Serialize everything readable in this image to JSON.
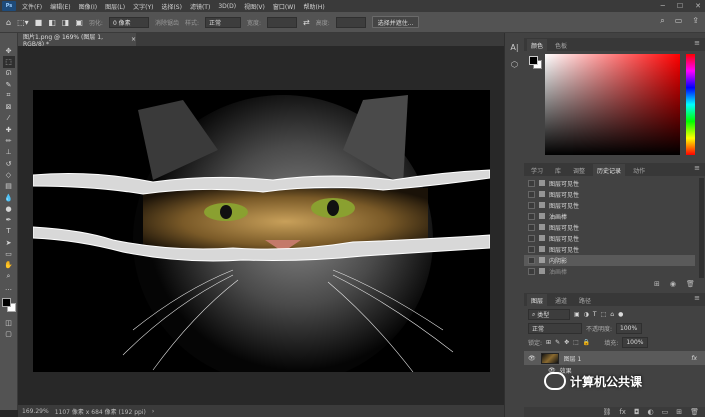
{
  "app": {
    "logo": "Ps"
  },
  "menu": [
    "文件(F)",
    "编辑(E)",
    "图像(I)",
    "图层(L)",
    "文字(Y)",
    "选择(S)",
    "滤镜(T)",
    "3D(D)",
    "视图(V)",
    "窗口(W)",
    "帮助(H)"
  ],
  "options": {
    "feather_label": "羽化:",
    "feather_value": "0 像素",
    "antialias_label": "消除锯齿",
    "style_label": "样式:",
    "style_value": "正常",
    "width_label": "宽度:",
    "height_label": "高度:",
    "select_mask_button": "选择并遮住..."
  },
  "document": {
    "tab_label": "图片1.png @ 169% (图层 1, RGB/8) *",
    "close": "×"
  },
  "status": {
    "zoom": "169.29%",
    "size": "1107 像素 x 684 像素 (192 ppi)",
    "arrow": "›"
  },
  "color_panel": {
    "tabs": [
      "颜色",
      "色板"
    ],
    "menu_icon": "menu-icon"
  },
  "history_panel": {
    "tabs": [
      "学习",
      "库",
      "调整",
      "历史记录",
      "动作"
    ],
    "active_tab": "历史记录",
    "items": [
      {
        "label": "图层可见性",
        "state": "normal"
      },
      {
        "label": "图层可见性",
        "state": "normal"
      },
      {
        "label": "图层可见性",
        "state": "normal"
      },
      {
        "label": "油画棒",
        "state": "normal"
      },
      {
        "label": "图层可见性",
        "state": "normal"
      },
      {
        "label": "图层可见性",
        "state": "normal"
      },
      {
        "label": "图层可见性",
        "state": "normal"
      },
      {
        "label": "内阴影",
        "state": "selected"
      },
      {
        "label": "油画棒",
        "state": "dim"
      }
    ]
  },
  "layers_panel": {
    "tabs": [
      "图层",
      "通道",
      "路径"
    ],
    "filter_value": "类型",
    "blend_mode": "正常",
    "opacity_label": "不透明度:",
    "opacity_value": "100%",
    "lock_label": "锁定:",
    "fill_label": "填充:",
    "fill_value": "100%",
    "layer_name": "图层 1",
    "fx_label": "fx",
    "effects_label": "效果"
  },
  "watermark": {
    "text": "计算机公共课"
  },
  "colors": {
    "fg": "#000000",
    "bg": "#ffffff",
    "accent": "#ff0000"
  }
}
